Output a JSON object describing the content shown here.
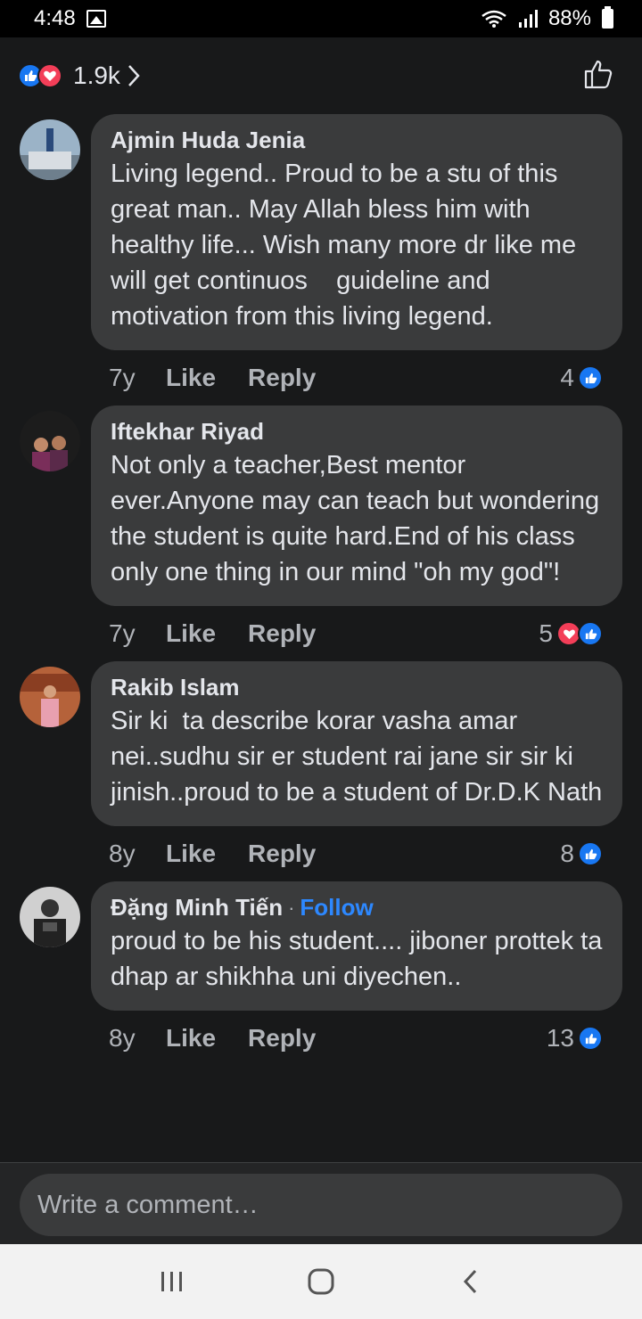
{
  "status_bar": {
    "time": "4:48",
    "battery": "88%"
  },
  "header": {
    "reaction_count": "1.9k"
  },
  "comments": [
    {
      "author": "Ajmin Huda Jenia",
      "follow": "",
      "text": "Living legend.. Proud to be a stu of this great man.. May Allah bless him with healthy life... Wish many more dr like me will get continuos    guideline and motivation from this living legend.",
      "time": "7y",
      "like_label": "Like",
      "reply_label": "Reply",
      "reaction_count": "4",
      "reactions": [
        "like"
      ]
    },
    {
      "author": "Iftekhar Riyad",
      "follow": "",
      "text": "Not only a teacher,Best mentor ever.Anyone may can teach but wondering the student is quite hard.End of his class only one thing in our mind \"oh my god\"!",
      "time": "7y",
      "like_label": "Like",
      "reply_label": "Reply",
      "reaction_count": "5",
      "reactions": [
        "love",
        "like"
      ]
    },
    {
      "author": "Rakib Islam",
      "follow": "",
      "text": "Sir ki  ta describe korar vasha amar nei..sudhu sir er student rai jane sir sir ki jinish..proud to be a student of Dr.D.K Nath",
      "time": "8y",
      "like_label": "Like",
      "reply_label": "Reply",
      "reaction_count": "8",
      "reactions": [
        "like"
      ]
    },
    {
      "author": "Đặng Minh Tiến",
      "follow": "Follow",
      "text": "proud to be his student.... jiboner prottek ta dhap ar shikhha uni diyechen..",
      "time": "8y",
      "like_label": "Like",
      "reply_label": "Reply",
      "reaction_count": "13",
      "reactions": [
        "like"
      ]
    }
  ],
  "composer": {
    "placeholder": "Write a comment…"
  },
  "colors": {
    "background": "#18191a",
    "bubble": "#3a3b3c",
    "like": "#1877f2",
    "love": "#f33e58",
    "link": "#2d88ff"
  },
  "icons": [
    "gallery-icon",
    "wifi-icon",
    "signal-icon",
    "battery-icon",
    "like-reaction-icon",
    "love-reaction-icon",
    "chevron-right-icon",
    "thumbs-up-icon",
    "recent-apps-icon",
    "home-icon",
    "back-icon"
  ]
}
